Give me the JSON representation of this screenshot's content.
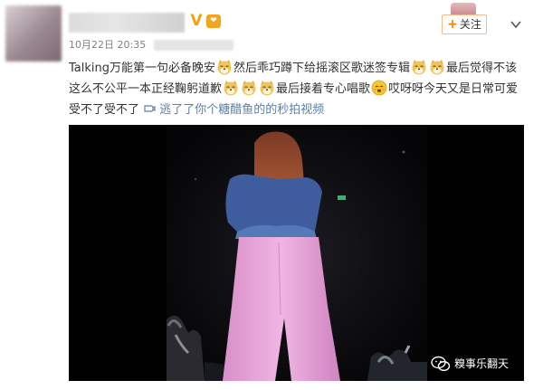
{
  "post": {
    "timestamp": "10月22日 20:35",
    "follow_label": "关注",
    "text_segments": [
      {
        "type": "text",
        "value": "Talking万能第一句必备晚安"
      },
      {
        "type": "emoji",
        "icon": "doge-emoji"
      },
      {
        "type": "text",
        "value": "然后乖巧蹲下给摇滚区歌迷签专辑"
      },
      {
        "type": "emoji",
        "icon": "doge-emoji"
      },
      {
        "type": "emoji",
        "icon": "doge-emoji"
      },
      {
        "type": "text",
        "value": "最后觉得不该这么不公平一本正经鞠躬道歉"
      },
      {
        "type": "emoji",
        "icon": "doge-emoji"
      },
      {
        "type": "emoji",
        "icon": "doge-emoji"
      },
      {
        "type": "emoji",
        "icon": "doge-emoji"
      },
      {
        "type": "text",
        "value": "最后接着专心唱歌"
      },
      {
        "type": "emoji",
        "icon": "shy-emoji"
      },
      {
        "type": "text",
        "value": "哎呀呀今天又是日常可爱受不了受不了"
      }
    ],
    "video_link": "逃了了你个糖醋鱼的的秒拍视频"
  },
  "watermark": "糗事乐翻天",
  "colors": {
    "accent_orange": "#ff8200",
    "link_blue": "#5d7fa6",
    "text": "#333333",
    "meta": "#808080",
    "video_bg": "#050507",
    "pants_pink": "#e8a4d8",
    "top_blue": "#3f5d9c",
    "hair": "#9c4a2c"
  }
}
